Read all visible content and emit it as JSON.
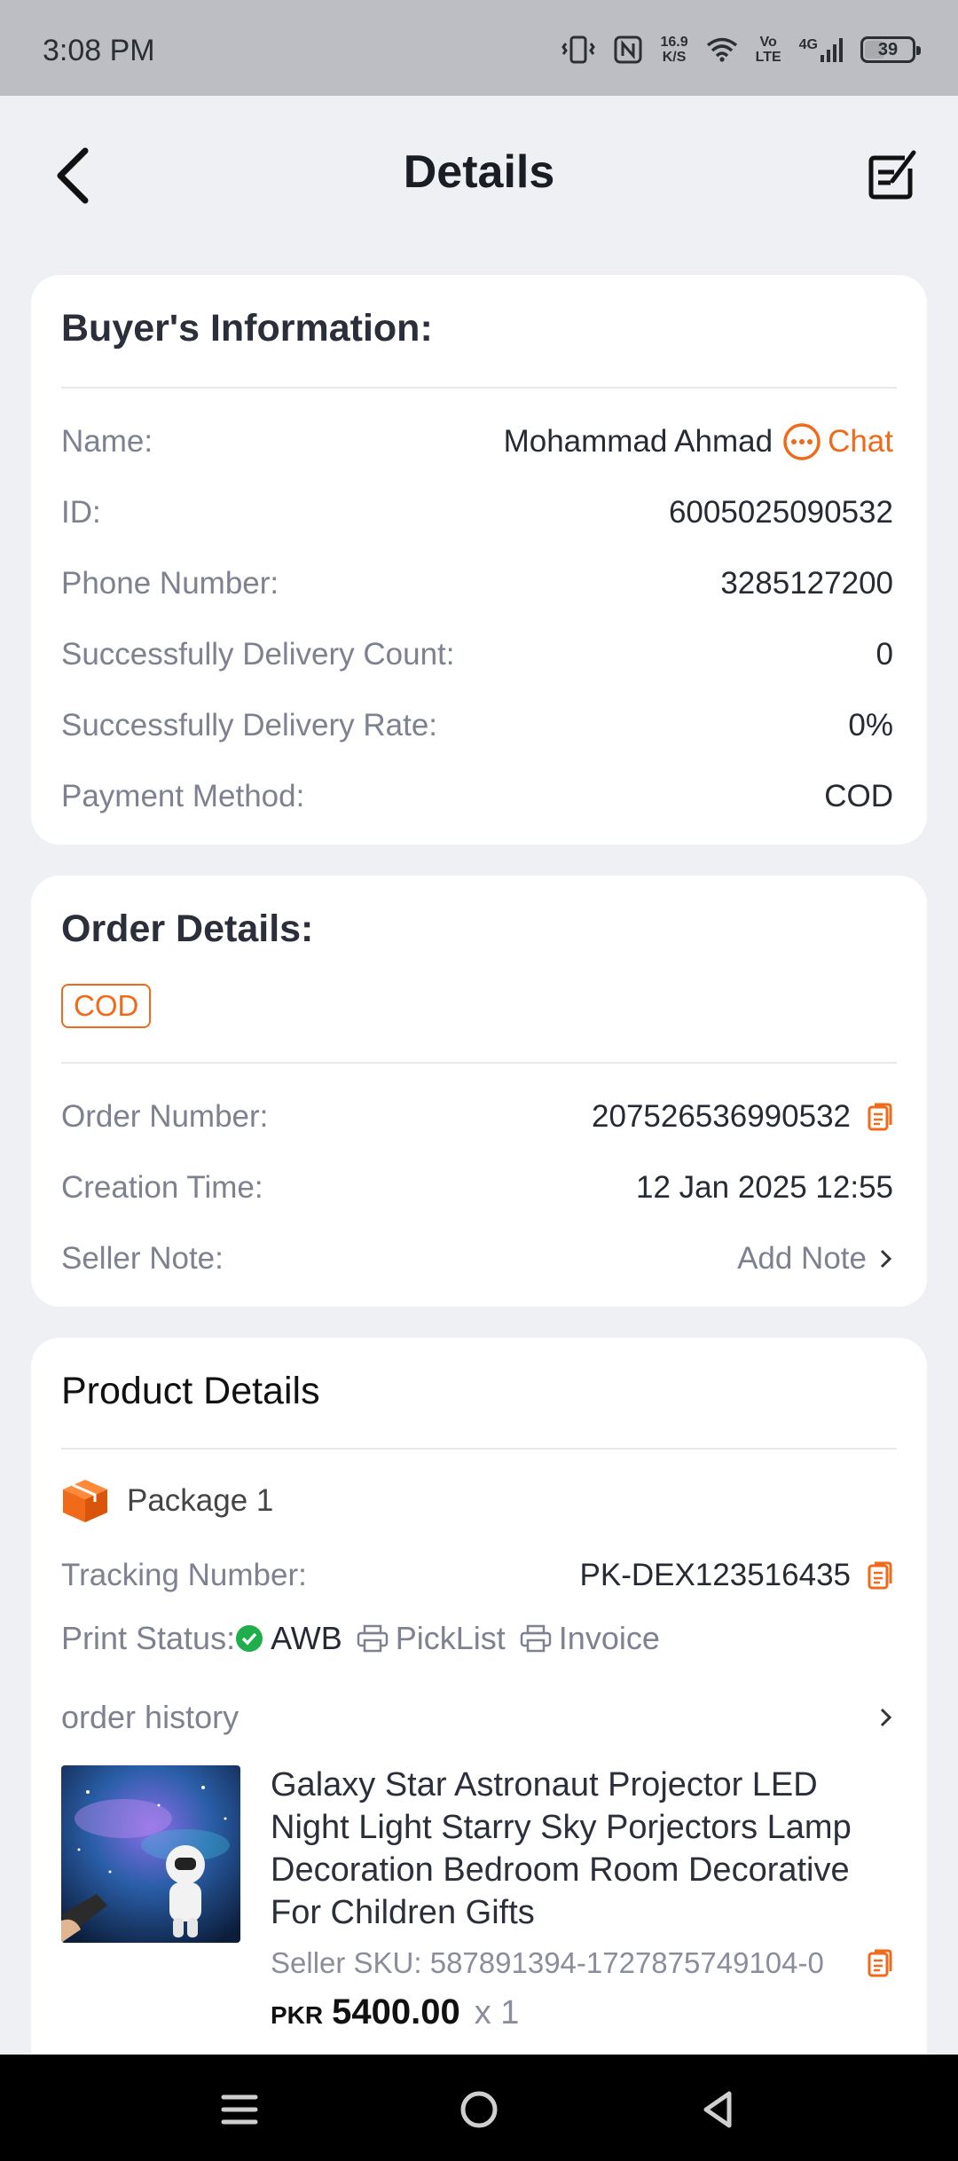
{
  "status_bar": {
    "time": "3:08 PM",
    "net_speed": "16.9",
    "net_unit": "K/S",
    "volte_top": "Vo",
    "volte_bottom": "LTE",
    "network": "4G",
    "battery": "39"
  },
  "header": {
    "title": "Details",
    "back_icon": "chevron-left-icon",
    "edit_icon": "edit-note-icon"
  },
  "buyer": {
    "title": "Buyer's Information:",
    "rows": [
      {
        "label": "Name:",
        "value": "Mohammad Ahmad"
      },
      {
        "label": "ID:",
        "value": "6005025090532"
      },
      {
        "label": "Phone Number:",
        "value": "3285127200"
      },
      {
        "label": "Successfully Delivery Count:",
        "value": "0"
      },
      {
        "label": "Successfully Delivery Rate:",
        "value": "0%"
      },
      {
        "label": "Payment Method:",
        "value": "COD"
      }
    ],
    "chat_label": "Chat"
  },
  "order": {
    "title": "Order Details:",
    "badge": "COD",
    "rows": [
      {
        "label": "Order Number:",
        "value": "207526536990532"
      },
      {
        "label": "Creation Time:",
        "value": "12 Jan 2025 12:55"
      },
      {
        "label": "Seller Note:",
        "value": "Add Note"
      }
    ]
  },
  "product": {
    "title": "Product Details",
    "package_label": "Package 1",
    "tracking_label": "Tracking Number:",
    "tracking_value": "PK-DEX123516435",
    "print_status_label": "Print Status:",
    "print_items": [
      "AWB",
      "PickList",
      "Invoice"
    ],
    "order_history": "order history",
    "item": {
      "name": "Galaxy Star Astronaut Projector LED Night Light Starry Sky Porjectors Lamp Decoration Bedroom Room Decorative For Children Gifts",
      "sku": "Seller SKU: 587891394-1727875749104-0",
      "currency": "PKR",
      "price": "5400.00",
      "qty": "x 1"
    }
  },
  "colors": {
    "accent": "#f06a1a",
    "success": "#1fae4b",
    "background": "#eef0f4"
  }
}
